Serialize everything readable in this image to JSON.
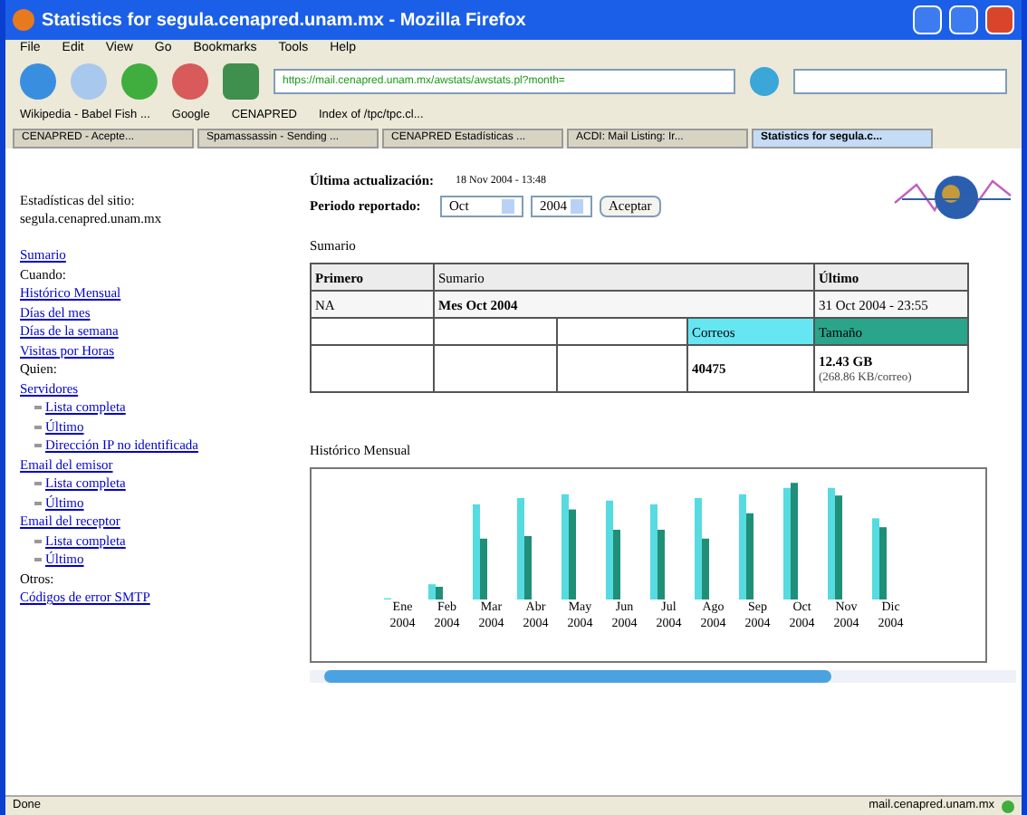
{
  "window": {
    "title": "Statistics for segula.cenapred.unam.mx - Mozilla Firefox"
  },
  "menu": [
    "File",
    "Edit",
    "View",
    "Go",
    "Bookmarks",
    "Tools",
    "Help"
  ],
  "address": {
    "value": "https://mail.cenapred.unam.mx/awstats/awstats.pl?month="
  },
  "bookmarks": [
    "Wikipedia - Babel Fish ...",
    "Google",
    "CENAPRED",
    "Index of /tpc/tpc.cl..."
  ],
  "tabs": [
    {
      "label": "CENAPRED - Acepte...",
      "selected": false
    },
    {
      "label": "Spamassassin - Sending ...",
      "selected": false
    },
    {
      "label": "CENAPRED Estadísticas ...",
      "selected": false
    },
    {
      "label": "ACDI: Mail Listing: Ir...",
      "selected": false
    },
    {
      "label": "Statistics for segula.c...",
      "selected": true
    }
  ],
  "sidebar": {
    "title": "Estadísticas del sitio:",
    "site": "segula.cenapred.unam.mx",
    "items": [
      {
        "kind": "link",
        "label": "Sumario"
      },
      {
        "kind": "heading",
        "label": "Cuando:"
      },
      {
        "kind": "link",
        "label": "Histórico Mensual"
      },
      {
        "kind": "link",
        "label": "Días del mes"
      },
      {
        "kind": "link",
        "label": "Días de la semana"
      },
      {
        "kind": "link",
        "label": "Visitas por Horas"
      },
      {
        "kind": "heading",
        "label": "Quien:"
      },
      {
        "kind": "link",
        "label": "Servidores",
        "children": [
          {
            "label": "Lista completa"
          },
          {
            "label": "Último"
          },
          {
            "label": "Dirección IP no identificada"
          }
        ]
      },
      {
        "kind": "link",
        "label": "Email del emisor",
        "children": [
          {
            "label": "Lista completa"
          },
          {
            "label": "Último"
          }
        ]
      },
      {
        "kind": "link",
        "label": "Email del receptor",
        "children": [
          {
            "label": "Lista completa"
          },
          {
            "label": "Último"
          }
        ]
      },
      {
        "kind": "heading",
        "label": "Otros:"
      },
      {
        "kind": "link",
        "label": "Códigos de error SMTP"
      }
    ]
  },
  "header": {
    "updated_label": "Última actualización:",
    "updated_value": "18 Nov 2004 - 13:48",
    "period_label": "Periodo reportado:",
    "month": "Oct",
    "year": "2004",
    "button": "Aceptar"
  },
  "summary": {
    "title": "Sumario",
    "first_label": "Primero",
    "mid_label": "Sumario",
    "last_label": "Último",
    "first_value": "NA",
    "period": "Mes Oct 2004",
    "last_value": "31 Oct 2004 - 23:55",
    "mails_label": "Correos",
    "size_label": "Tamaño",
    "mails": "40475",
    "size": "12.43 GB",
    "size_per": "(268.86 KB/correo)"
  },
  "history": {
    "title": "Histórico Mensual",
    "months": [
      [
        "Ene",
        "2004"
      ],
      [
        "Feb",
        "2004"
      ],
      [
        "Mar",
        "2004"
      ],
      [
        "Abr",
        "2004"
      ],
      [
        "May",
        "2004"
      ],
      [
        "Jun",
        "2004"
      ],
      [
        "Jul",
        "2004"
      ],
      [
        "Ago",
        "2004"
      ],
      [
        "Sep",
        "2004"
      ],
      [
        "Oct",
        "2004"
      ],
      [
        "Nov",
        "2004"
      ],
      [
        "Dic",
        "2004"
      ]
    ]
  },
  "status_bar": {
    "left": "Done",
    "right": "mail.cenapred.unam.mx"
  }
}
